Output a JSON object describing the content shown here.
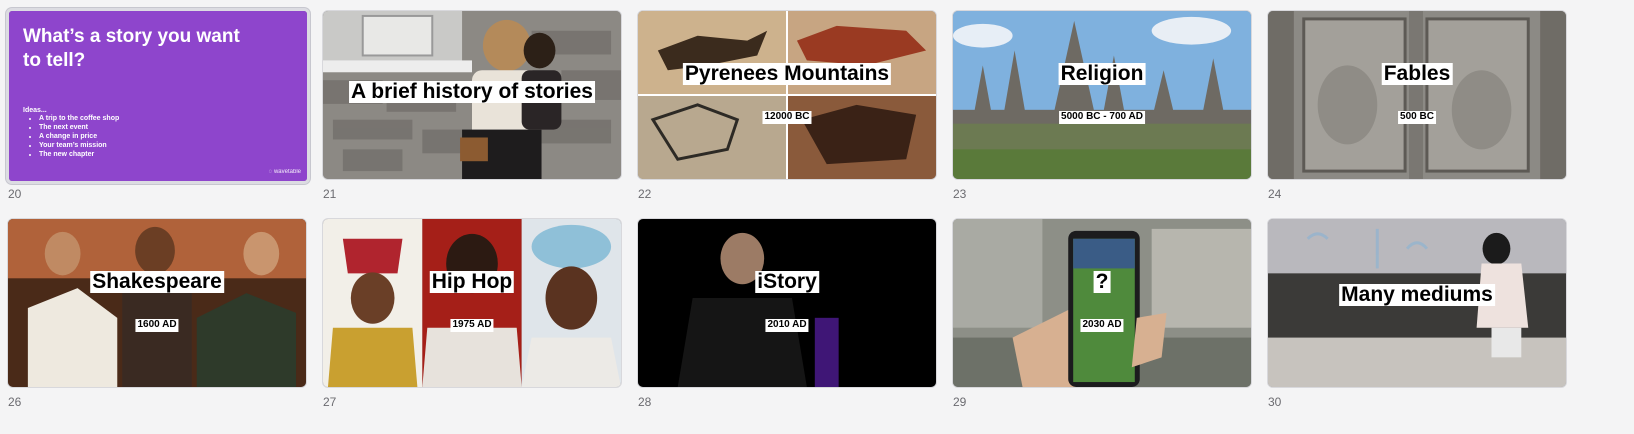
{
  "slides": [
    {
      "number": "20",
      "title": "What’s a story you want to tell?",
      "ideas_label": "Ideas...",
      "ideas": [
        "A trip to the coffee shop",
        "The next event",
        "A change in price",
        "Your team’s mission",
        "The new chapter"
      ],
      "brand": "wavetable"
    },
    {
      "number": "21",
      "heading": "A brief history of stories",
      "date": ""
    },
    {
      "number": "22",
      "heading": "Pyrenees Mountains",
      "date": "12000 BC"
    },
    {
      "number": "23",
      "heading": "Religion",
      "date": "5000 BC - 700 AD"
    },
    {
      "number": "24",
      "heading": "Fables",
      "date": "500 BC"
    },
    {
      "number": "26",
      "heading": "Shakespeare",
      "date": "1600 AD"
    },
    {
      "number": "27",
      "heading": "Hip Hop",
      "date": "1975 AD"
    },
    {
      "number": "28",
      "heading": "iStory",
      "date": "2010 AD"
    },
    {
      "number": "29",
      "heading": "?",
      "date": "2030 AD"
    },
    {
      "number": "30",
      "heading": "Many mediums",
      "date": ""
    }
  ],
  "colors": {
    "cover_bg": "#8e45cc",
    "canvas_bg": "#f4f4f5"
  },
  "icons": [
    "wavetable-logo-icon"
  ]
}
